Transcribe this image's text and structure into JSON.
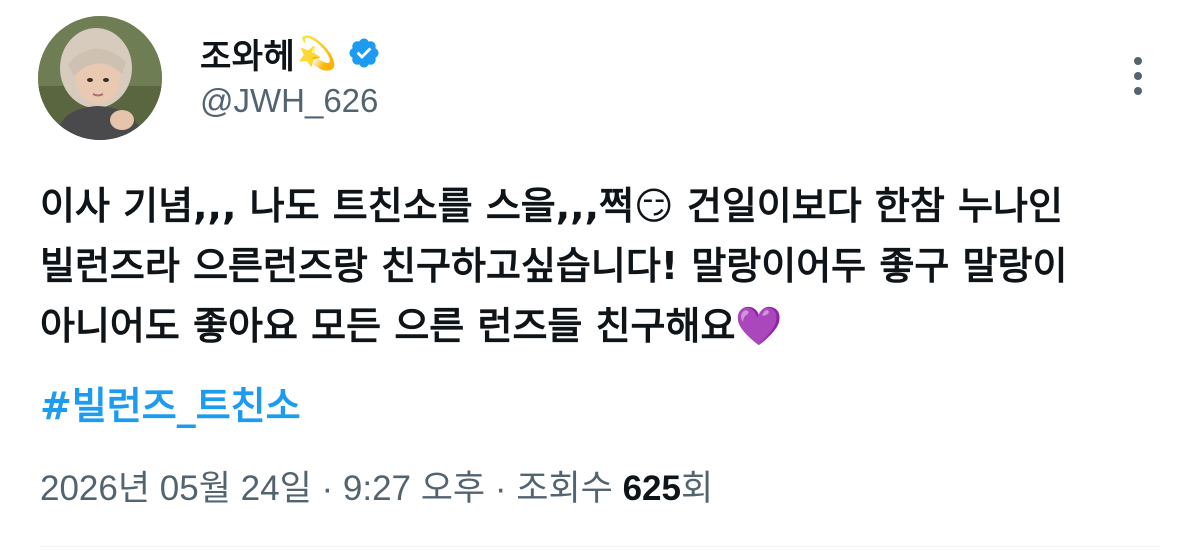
{
  "author": {
    "display_name": "조와헤",
    "name_emoji": "💫",
    "handle": "@JWH_626",
    "verified": true,
    "avatar_icon": "profile-photo"
  },
  "tweet": {
    "lines": [
      "이사 기념,,, 나도 트친소를 스을,,,쩍😏 건일이보다 한참 누나인",
      "빌런즈라 으른런즈랑 친구하고싶습니다! 말랑이어두 좋구 말랑이",
      "아니어도 좋아요 모든 으른 런즈들 친구해요💜"
    ],
    "hashtag": "#빌런즈_트친소"
  },
  "meta": {
    "date": "2026년 05월 24일",
    "sep1": " · ",
    "time": "9:27 오후",
    "sep2": " · ",
    "views_label": "조회수 ",
    "views_count": "625",
    "views_suffix": "회"
  },
  "colors": {
    "text": "#0f1419",
    "secondary": "#536471",
    "link": "#1d9bf0",
    "verified": "#1d9bf0"
  }
}
